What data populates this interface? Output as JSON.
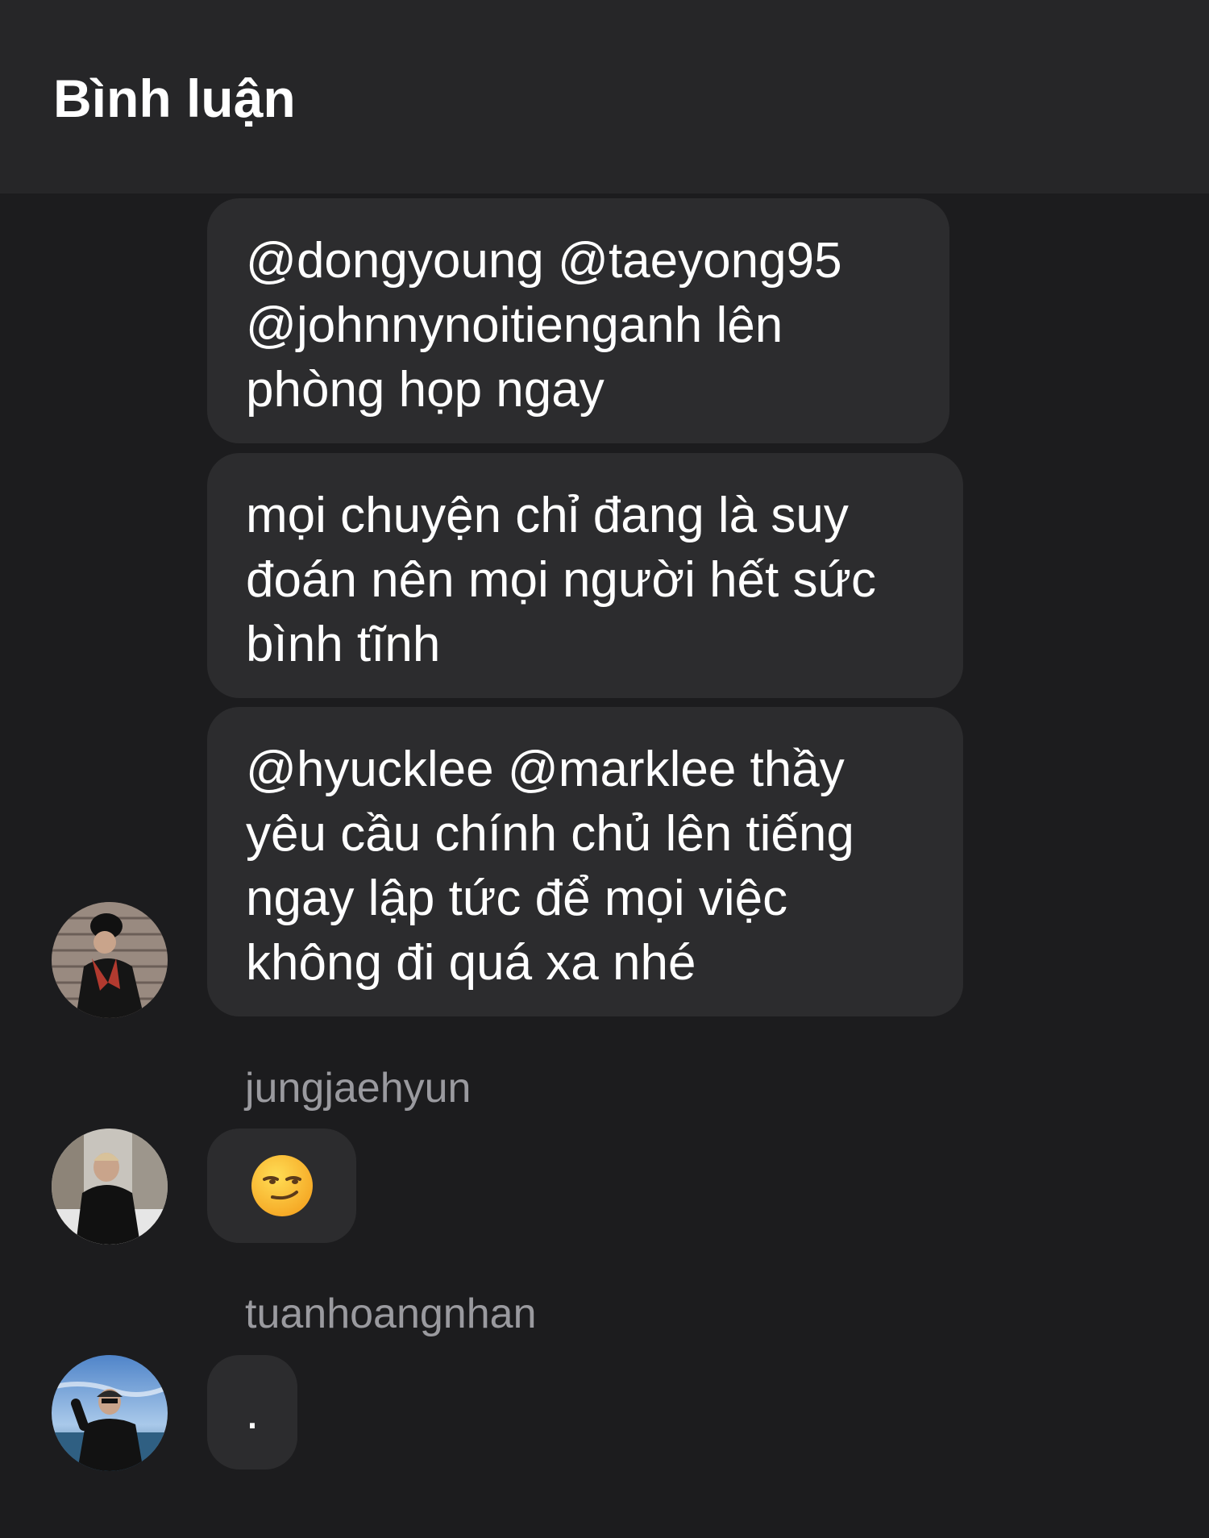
{
  "header": {
    "title": "Bình luận"
  },
  "comments": [
    {
      "lines": [
        "@dongyoung @taeyong95",
        "@johnnynoitienganh lên",
        "phòng họp ngay"
      ]
    },
    {
      "lines": [
        "mọi chuyện chỉ đang là suy",
        "đoán nên mọi người hết sức",
        "bình tĩnh"
      ]
    },
    {
      "lines": [
        "@hyucklee @marklee thầy",
        "yêu cầu chính chủ lên tiếng",
        "ngay lập tức để mọi việc",
        "không đi quá xa nhé"
      ]
    },
    {
      "username": "jungjaehyun",
      "text": "😏",
      "icon": "smirk-emoji-icon"
    },
    {
      "username": "tuanhoangnhan",
      "text": "."
    }
  ],
  "colors": {
    "background": "#1c1c1e",
    "header": "#262628",
    "bubble": "#2c2c2e",
    "username": "#9a9a9f",
    "text": "#ffffff"
  }
}
